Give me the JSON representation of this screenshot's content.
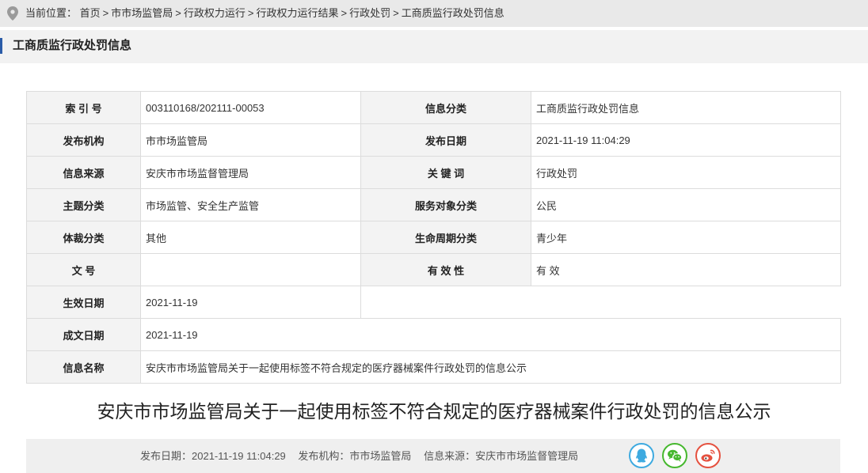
{
  "breadcrumb": {
    "prefix": "当前位置：",
    "items": [
      "首页",
      "市市场监管局",
      "行政权力运行",
      "行政权力运行结果",
      "行政处罚",
      "工商质监行政处罚信息"
    ]
  },
  "section": {
    "title": "工商质监行政处罚信息"
  },
  "meta": {
    "index_label": "索 引 号",
    "index_value": "003110168/202111-00053",
    "category_label": "信息分类",
    "category_value": "工商质监行政处罚信息",
    "publisher_label": "发布机构",
    "publisher_value": "市市场监管局",
    "pubdate_label": "发布日期",
    "pubdate_value": "2021-11-19 11:04:29",
    "source_label": "信息来源",
    "source_value": "安庆市市场监督管理局",
    "keyword_label": "关 键 词",
    "keyword_value": "行政处罚",
    "topic_label": "主题分类",
    "topic_value": "市场监管、安全生产监管",
    "service_label": "服务对象分类",
    "service_value": "公民",
    "genre_label": "体裁分类",
    "genre_value": "其他",
    "lifecycle_label": "生命周期分类",
    "lifecycle_value": "青少年",
    "docno_label": "文 号",
    "docno_value": "",
    "validity_label": "有 效 性",
    "validity_value": "有 效",
    "effective_label": "生效日期",
    "effective_value": "2021-11-19",
    "written_label": "成文日期",
    "written_value": "2021-11-19",
    "name_label": "信息名称",
    "name_value": "安庆市市场监管局关于一起使用标签不符合规定的医疗器械案件行政处罚的信息公示"
  },
  "document": {
    "title": "安庆市市场监管局关于一起使用标签不符合规定的医疗器械案件行政处罚的信息公示"
  },
  "footer": {
    "pubdate": "发布日期：2021-11-19 11:04:29",
    "publisher": "发布机构：市市场监管局",
    "source": "信息来源：安庆市市场监督管理局"
  },
  "share": {
    "icons": [
      "qq-icon",
      "wechat-icon",
      "weibo-icon"
    ],
    "colors": {
      "qq": "#3eaae0",
      "wechat": "#46b82e",
      "weibo": "#e5513f",
      "bg": "#efefef"
    }
  }
}
